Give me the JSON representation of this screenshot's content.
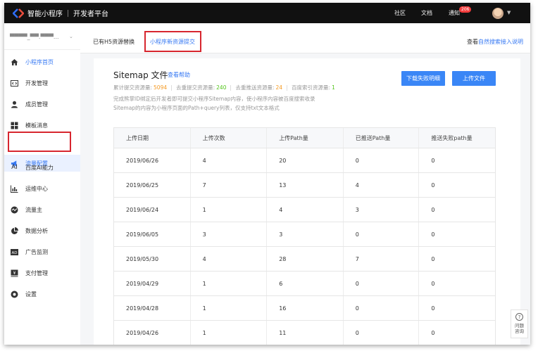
{
  "header": {
    "brand": "智能小程序",
    "platform": "开发者平台",
    "nav": [
      {
        "label": "社区"
      },
      {
        "label": "文档"
      },
      {
        "label": "通知"
      }
    ],
    "notification_count": "206",
    "logo_color": "#2f6df6"
  },
  "sidebar": {
    "account_name": "▀▀▀▀_▀▀.▀▀▀...",
    "items": [
      {
        "label": "小程序首页",
        "icon": "home-icon"
      },
      {
        "label": "开发管理",
        "icon": "code-icon"
      },
      {
        "label": "成员管理",
        "icon": "user-icon"
      },
      {
        "label": "模板消息",
        "icon": "template-icon"
      },
      {
        "label": "流量配置",
        "icon": "megaphone-icon"
      },
      {
        "label": "百度AI能力",
        "icon": "ai-icon"
      },
      {
        "label": "运维中心",
        "icon": "ops-chart-icon"
      },
      {
        "label": "流量主",
        "icon": "traffic-icon"
      },
      {
        "label": "数据分析",
        "icon": "pie-chart-icon"
      },
      {
        "label": "广告监测",
        "icon": "ad-icon"
      },
      {
        "label": "支付管理",
        "icon": "payment-icon"
      },
      {
        "label": "设置",
        "icon": "gear-icon"
      }
    ],
    "active_index": 4
  },
  "tabs": [
    {
      "label": "已有H5资源替换"
    },
    {
      "label": "小程序新资源提交"
    }
  ],
  "active_tab": 1,
  "tab_right": {
    "prefix": "查看",
    "link": "自然搜索接入说明"
  },
  "card": {
    "title": "Sitemap 文件",
    "help": "查看帮助",
    "download_btn": "下载失败明细",
    "upload_btn": "上传文件",
    "stats": [
      {
        "label": "累计提交资源量:",
        "value": "5094",
        "color": "#f59a23"
      },
      {
        "label": "去重提交资源量:",
        "value": "240",
        "color": "#52c41a"
      },
      {
        "label": "去重推送资源量:",
        "value": "24",
        "color": "#f59a23"
      },
      {
        "label": "百度索引资源量:",
        "value": "1",
        "color": "#52c41a"
      }
    ],
    "desc1": "完成熊掌ID绑定后开发者即可提交小程序Sitemap内容，使小程序内容被百度搜索收录",
    "desc2": "Sitemap的内容为小程序页面的Path+query列表，仅支持txt文本格式"
  },
  "table": {
    "columns": [
      "上传日期",
      "上传次数",
      "上传Path量",
      "已推送Path量",
      "推送失败path量"
    ],
    "rows": [
      [
        "2019/06/26",
        "4",
        "20",
        "0",
        "0"
      ],
      [
        "2019/06/25",
        "7",
        "13",
        "4",
        "0"
      ],
      [
        "2019/06/24",
        "1",
        "4",
        "3",
        "0"
      ],
      [
        "2019/06/05",
        "3",
        "3",
        "0",
        "0"
      ],
      [
        "2019/05/30",
        "4",
        "28",
        "7",
        "0"
      ],
      [
        "2019/04/29",
        "1",
        "6",
        "0",
        "0"
      ],
      [
        "2019/04/28",
        "1",
        "16",
        "0",
        "0"
      ],
      [
        "2019/04/26",
        "1",
        "11",
        "0",
        "0"
      ]
    ]
  },
  "qa": {
    "icon": "question-icon",
    "label": "问题咨询"
  }
}
